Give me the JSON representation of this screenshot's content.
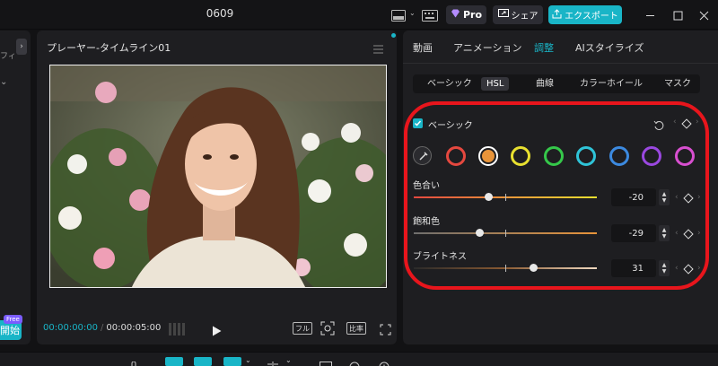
{
  "window": {
    "title": "0609",
    "pro_label": "Pro",
    "share_label": "シェア",
    "export_label": "エクスポート"
  },
  "left_panel": {
    "stub_text": "フィ",
    "free_tag": "Free",
    "start_label": "開始"
  },
  "player": {
    "title": "プレーヤー-タイムライン01",
    "current_time": "00:00:00:00",
    "separator": "/",
    "total_time": "00:00:05:00",
    "full_label": "フル",
    "ratio_label": "比率"
  },
  "right_panel": {
    "main_tabs": [
      {
        "label": "動画",
        "active": false
      },
      {
        "label": "アニメーション",
        "active": false
      },
      {
        "label": "調整",
        "active": true
      },
      {
        "label": "AIスタイライズ",
        "active": false
      }
    ],
    "sub_tabs": [
      {
        "label": "ベーシック",
        "active": false
      },
      {
        "label": "HSL",
        "active": true
      },
      {
        "label": "曲線",
        "active": false
      },
      {
        "label": "カラーホイール",
        "active": false
      },
      {
        "label": "マスク",
        "active": false
      }
    ],
    "hsl": {
      "section_label": "ベーシック",
      "enabled": true,
      "swatches": [
        {
          "color": "#e5483f",
          "selected": false
        },
        {
          "color": "#e8943a",
          "selected": true
        },
        {
          "color": "#e8e030",
          "selected": false
        },
        {
          "color": "#35c84a",
          "selected": false
        },
        {
          "color": "#2fc4d8",
          "selected": false
        },
        {
          "color": "#3c8ae0",
          "selected": false
        },
        {
          "color": "#9a48e0",
          "selected": false
        },
        {
          "color": "#d84fd0",
          "selected": false
        }
      ],
      "sliders": [
        {
          "label": "色合い",
          "value": "-20",
          "fraction": 0.41
        },
        {
          "label": "飽和色",
          "value": "-29",
          "fraction": 0.36
        },
        {
          "label": "ブライトネス",
          "value": "31",
          "fraction": 0.655
        }
      ]
    }
  },
  "highlight_color": "#e8151c",
  "accent_color": "#19b5c7"
}
